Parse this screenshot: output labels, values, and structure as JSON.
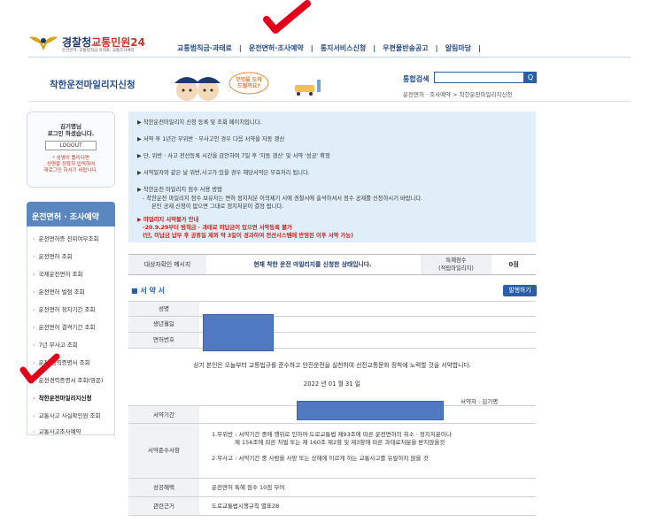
{
  "header": {
    "logo_title_main": "경찰청",
    "logo_title_accent": "교통민원24",
    "logo_sub": "운전면허, 교통범칙금·과태료, 교통조사예약",
    "nav": [
      "교통범칙금·과태료",
      "운전면허·조사예약",
      "통지서비스신청",
      "우편물반송공고",
      "알림마당"
    ],
    "nav_sep": "|"
  },
  "subheader": {
    "page_title": "착한운전마일리지신청",
    "banner_speech": "무엇을 도와드릴까요?",
    "search_label": "통합검색",
    "search_value": "",
    "search_button": "Q",
    "breadcrumb": "운전면허 · 조사예약 > 착한운전마일리지신청"
  },
  "login": {
    "name_line1": "김기명님",
    "name_line2": "로그인 하셨습니다.",
    "logout": "LOGOUT",
    "warn_line1": "* 성명이 틀리다면",
    "warn_line2": "성명을 정확히 입력하여",
    "warn_line3": "재로그인 하시기 바랍니다."
  },
  "sidebar": {
    "title": "운전면허 · 조사예약",
    "items": [
      "운전면허증 진위여부조회",
      "운전면허 조회",
      "국제운전면허 조회",
      "운전면허 벌점 조회",
      "운전면허 정지기간 조회",
      "운전면허 결격기간 조회",
      "7년 무사고 조회",
      "운전 경력증명서 조회",
      "운전경력증명서 조회(영문)",
      "착한운전마일리지신청",
      "교통사고 사실확인원 조회",
      "교통사고조사예약"
    ]
  },
  "info": {
    "lines": [
      "▶ 착한운전마일리지 신청 등록 및 조회 페이지입니다.",
      "▶ 서약 후 1년간 무위반 · 무사고인 경우 다음 서약을 자동 갱신",
      "▶ 단, 위반 · 사고 전산등록 시간을 감안하여 7일 후 '자동 갱신' 및 서약 '성공' 확정",
      "▶ 서약일자와 같은 날 위반,사고가 있을 경우 해당서약은 무효처리 됩니다.",
      "▶ 착한운전 마일리지 점수 사용 방법",
      "- 착한운전 마일리지 점수 보유자는 면허 정지처분 이의제기 시에 경찰서에 출석하셔서 점수 공제를 신청하시기 바랍니다.",
      "본인 공제 신청이 없으면 그대로 정지처분이 결정 됩니다.",
      "▶ 마일리지 서약불가 안내",
      "-20.9.29부터 범칙금 · 과태료 미납금이 있으면 서약등록 불가",
      "(단, 미납금 납부 후 공휴일 제외 약 3일이 경과하여 전산시스템에 반영된 이후 서약 가능)"
    ]
  },
  "status": {
    "label": "대상자확인 메시지",
    "message": "현재 착한 운전 마일리지를 신청한 상태입니다.",
    "points_label_1": "특혜점수",
    "points_label_2": "(적립마일리지)",
    "points_value": "0점"
  },
  "pledge": {
    "title": "■ 서 약 서",
    "issue_button": "발행하기",
    "name_label": "성명",
    "birth_label": "생년월일",
    "license_label": "면허번호",
    "statement": "상기 본인은 오늘부터 교통법규를 준수하고 안전운전을 실천하여 선진교통문화 정착에 노력할 것을 서약합니다.",
    "date": "2022 년 01 월 31 일",
    "signer": "서약자 : 김기명",
    "period_label": "서약기간",
    "rules_label": "서약준수사항",
    "rule1_line1": "1.무위반 : 서약기간 중에 행위로 인하여 도로교통법 제93조에 따른 운전면허의 취소 · 정지처분이나",
    "rule1_line2": "제 156조에 따른 처벌 또는 제 160조 제2항 및 제3항에 따른 과태료처분을 받지않을것",
    "rule2": "2.무사고 : 서약기간 중 사람을 사망 또는 상해에 이르게 하는 교통사고를 유발하지 않을 것",
    "benefit_label": "성공혜택",
    "benefit": "운전면허 특혜 점수 10점 부여",
    "law_label": "관련근거",
    "law": "도로교통법시행규칙 별표28"
  }
}
